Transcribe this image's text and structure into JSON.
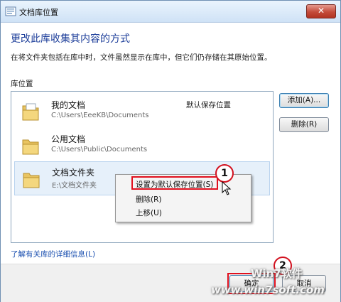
{
  "window": {
    "title": "文档库位置",
    "close_label": "✕"
  },
  "heading": "更改此库收集其内容的方式",
  "description": "在将文件夹包括在库中时，文件虽然显示在库中，但它们仍存储在其原始位置。",
  "section_label": "库位置",
  "locations": [
    {
      "name": "我的文档",
      "path": "C:\\Users\\EeeKB\\Documents",
      "default_label": "默认保存位置"
    },
    {
      "name": "公用文档",
      "path": "C:\\Users\\Public\\Documents",
      "default_label": ""
    },
    {
      "name": "文档文件夹",
      "path": "E:\\文档文件夹",
      "default_label": ""
    }
  ],
  "buttons": {
    "add": "添加(A)...",
    "remove": "删除(R)",
    "ok": "确定",
    "cancel": "取消"
  },
  "context_menu": {
    "items": [
      "设置为默认保存位置(S)",
      "删除(R)",
      "上移(U)"
    ]
  },
  "callouts": {
    "step1": "1",
    "step2": "2"
  },
  "link": "了解有关库的详细信息(L)",
  "watermark": {
    "line1": "Win7软件",
    "line2": "www.win7soft.com"
  },
  "colors": {
    "heading": "#1d3e9a",
    "link": "#1a4fb0",
    "highlight": "#e0101e"
  },
  "icons": [
    "folder-icon",
    "library-icon",
    "close-icon",
    "cursor-icon"
  ]
}
